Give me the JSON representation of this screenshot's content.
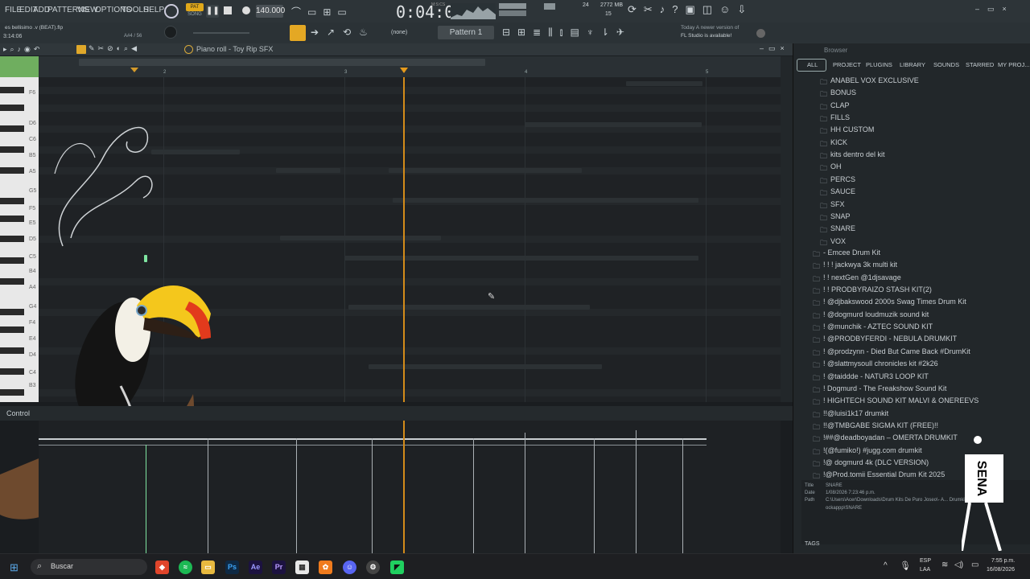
{
  "menu": [
    "FILE",
    "EDIT",
    "ADD",
    "PATTERNS",
    "VIEW",
    "OPTIONS",
    "TOOLS",
    "HELP"
  ],
  "pat_song": {
    "pat": "PAT",
    "song": "SONG"
  },
  "tempo": "140.000",
  "time": "0:04:00",
  "time_label": "M:S:CS",
  "cpu": {
    "value": "24",
    "mem": "2772 MB",
    "voices": "15"
  },
  "hint": {
    "line1": "Today  A newer version of",
    "line2": "FL Studio is available!"
  },
  "project": {
    "file": "es bellisimo .v (BEAT).flp",
    "position": "3:14:06",
    "note": "A#4 / 56"
  },
  "pattern_none": "(none)",
  "pattern_name": "Pattern 1",
  "pianoroll": {
    "title": "Piano roll - Toy Rip SFX"
  },
  "ruler": [
    "2",
    "3",
    "4",
    "5"
  ],
  "keys": [
    "F6",
    "D6",
    "C6",
    "B5",
    "A5",
    "G5",
    "F5",
    "E5",
    "D5",
    "C5",
    "B4",
    "A4",
    "G4",
    "F4",
    "E4",
    "D4",
    "C4",
    "B3"
  ],
  "control_label": "Control",
  "browser": {
    "title": "Browser",
    "tabs": [
      "ALL",
      "PROJECT",
      "PLUGINS",
      "LIBRARY",
      "SOUNDS",
      "STARRED",
      "MY PROJ..."
    ],
    "subfolders": [
      "ANABEL VOX EXCLUSIVE",
      "BONUS",
      "CLAP",
      "FILLS",
      "HH CUSTOM",
      "KICK",
      "kits dentro del kit",
      "OH",
      "PERCS",
      "SAUCE",
      "SFX",
      "SNAP",
      "SNARE",
      "VOX"
    ],
    "folders": [
      "- Emcee Drum Kit",
      "! ! ! jackwya 3k multi kit",
      "! ! nextGen @1djsavage",
      "! ! PRODBYRAIZO STASH KIT(2)",
      "! @djbakswood 2000s Swag Times Drum Kit",
      "! @dogmurd loudmuzik sound kit",
      "! @munchik - AZTEC SOUND KIT",
      "! @PRODBYFERDI - NEBULA DRUMKIT",
      "! @prodzynn - Died But Came Back #DrumKit",
      "! @slattmysoull chronicles kit #2k26",
      "! @taiddde - NATUR3 LOOP KIT",
      "! Dogmurd - The Freakshow Sound Kit",
      "! HIGHTECH SOUND KIT MALVI & ONEREEVS",
      "!!@luisi1k17 drumkit",
      "!!@TMBGABE SIGMA KIT (FREE)!!",
      "!##@deadboyadan – OMERTA DRUMKIT",
      "!(@fumiko!) #jugg.com drumkit",
      "!@ dogmurd 4k (DLC VERSION)",
      "!@Prod.tomii Essential Drum Kit 2025"
    ],
    "info": {
      "title_label": "Title",
      "title": "SNARE",
      "date_label": "Date",
      "date": "1/08/2026 7:23:46 p.m.",
      "path_label": "Path",
      "path1": "C:\\Users\\Acer\\Downloads\\Drum Kits De Puro Joseo\\- A... Drumkit By @-",
      "path2": "ockappp\\SNARE"
    },
    "tags": "TAGS"
  },
  "taskbar": {
    "search": "Buscar",
    "lang1": "ESP",
    "lang2": "LAA",
    "clock_time": "7:55 p.m.",
    "clock_date": "16/08/2026"
  },
  "watermark": "SENA"
}
